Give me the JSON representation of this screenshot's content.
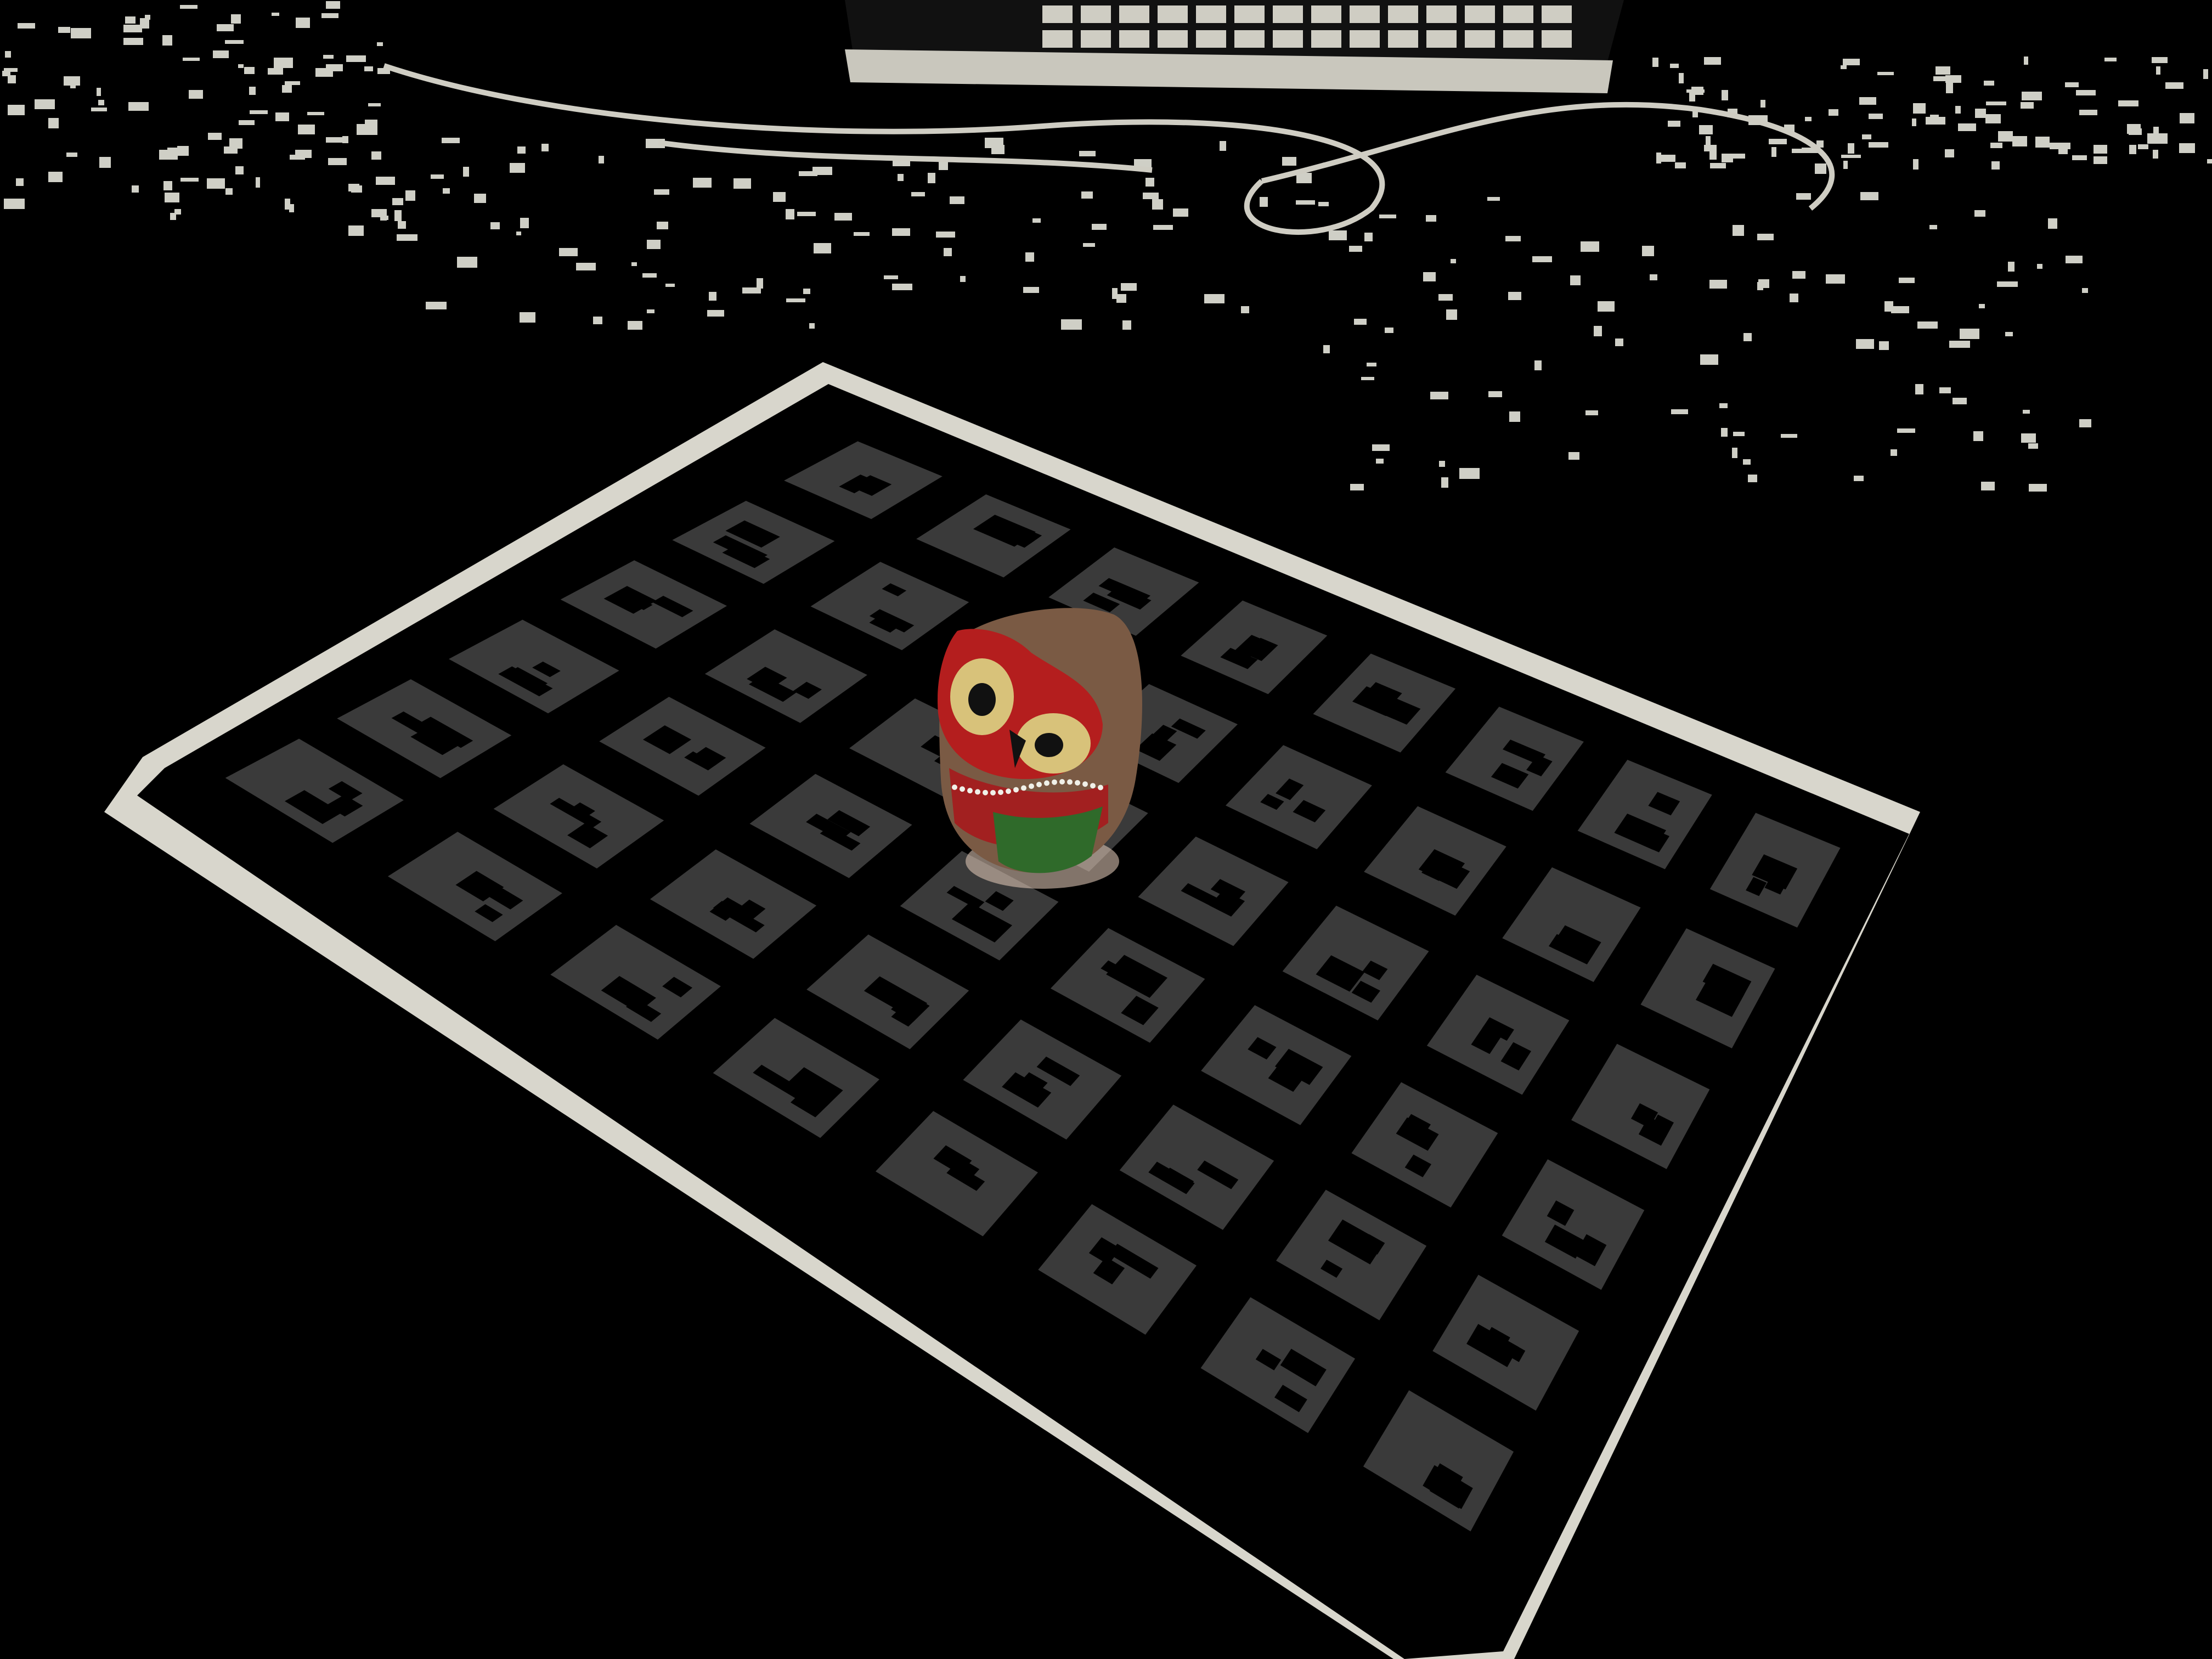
{
  "scene": {
    "subject": "owl-figurine",
    "calibration_board": {
      "rows": 6,
      "cols": 8
    },
    "colors": {
      "background": "#000000",
      "board_edge": "#d8d6cc",
      "marker_fill": "#3a3a3a",
      "desk_highlight": "#cfcfc6",
      "owl_brown": "#7a5a44",
      "owl_red": "#b41e1e",
      "owl_yellow": "#d8c27a",
      "owl_green": "#2f6a2a"
    }
  }
}
